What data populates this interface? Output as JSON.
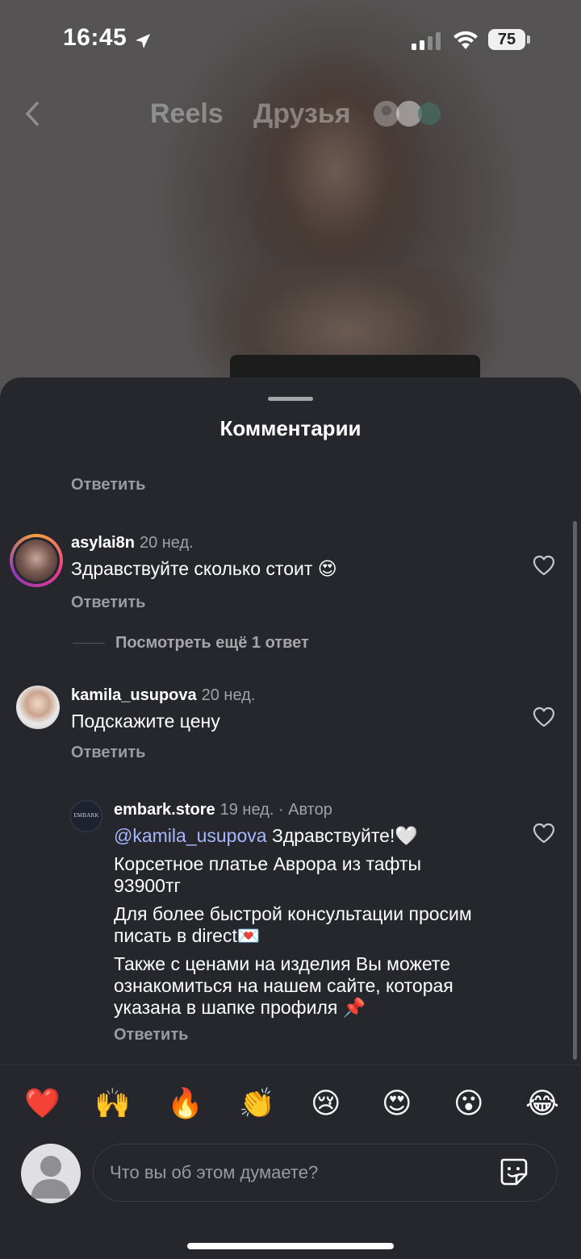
{
  "status": {
    "time": "16:45",
    "battery": "75"
  },
  "nav": {
    "tab_reels": "Reels",
    "tab_friends": "Друзья"
  },
  "sheet": {
    "title": "Комментарии",
    "reply_label": "Ответить",
    "more_replies": "Посмотреть ещё 1 ответ"
  },
  "comments": [
    {
      "username": "asylai8n",
      "time": "20 нед.",
      "text": "Здравствуйте сколько стоит 😍"
    },
    {
      "username": "kamila_usupova",
      "time": "20 нед.",
      "text": "Подскажите цену"
    },
    {
      "username": "embark.store",
      "time": "19 нед. · Автор",
      "avatar_text": "EMBARK",
      "mention": "@kamila_usupova",
      "text_line1": " Здравствуйте!🤍",
      "text_line2": "Корсетное платье Аврора из тафты",
      "text_line3": "93900тг",
      "text_line4": "Для более быстрой консультации просим",
      "text_line5": "писать в direct💌",
      "text_line6": "Также с ценами на изделия Вы можете",
      "text_line7": "ознакомиться на нашем сайте, которая",
      "text_line8": "указана в шапке профиля 📌"
    }
  ],
  "reactions": [
    "❤️",
    "🙌",
    "🔥",
    "👏",
    "😢",
    "😍",
    "😮",
    "😂"
  ],
  "input": {
    "placeholder": "Что вы об этом думаете?"
  }
}
